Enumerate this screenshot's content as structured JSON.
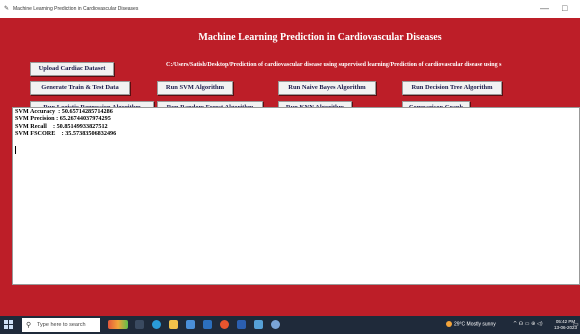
{
  "window": {
    "title": "Machine Learning Prediction in Cardiovascular Diseases",
    "icon": "feather-icon",
    "minimize": "—",
    "maximize": "□"
  },
  "app": {
    "heading": "Machine Learning Prediction in Cardiovascular Diseases",
    "dataset_path": "C:/Users/Satish/Desktop/Prediction of cardiovascular disease using supervised learning/Prediction of cardiovascular disease using s",
    "accent_color": "#bd1e28",
    "buttons": {
      "upload": "Upload Cardiac Dataset",
      "generate": "Generate Train & Test Data",
      "svm": "Run SVM Algorithm",
      "naive_bayes": "Run Naive Bayes Algorithm",
      "decision_tree": "Run Decision Tree Algorithm",
      "logistic": "Run Logistic Regression Algorithm",
      "random_forest": "Run Random Forest Algorithm",
      "knn": "Run KNN Algorithm",
      "comparison": "Comparison Graph"
    },
    "output_lines": [
      "SVM Accuracy  : 50.65714285714286",
      "SVM Precision : 65.26744037974295",
      "SVM Recall    : 50.85149933827512",
      "SVM FSCORE    : 35.57383506832496"
    ]
  },
  "taskbar": {
    "search_placeholder": "Type here to search",
    "weather": "29°C  Mostly sunny",
    "tray_icons": "^  ☊  ▭  ⊕  ◁)",
    "time": "05:42 PM",
    "date": "13-06-2023"
  }
}
